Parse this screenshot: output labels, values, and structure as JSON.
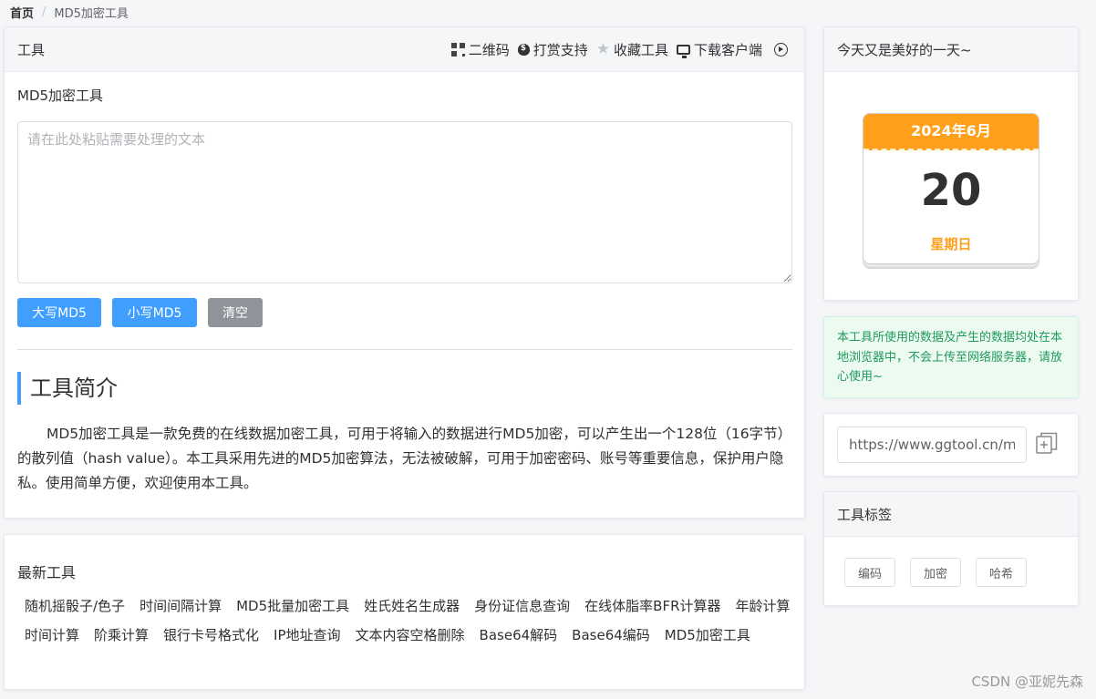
{
  "breadcrumb": {
    "home": "首页",
    "separator": "/",
    "current": "MD5加密工具"
  },
  "main": {
    "header_title": "工具",
    "actions": {
      "qr": "二维码",
      "donate": "打赏支持",
      "favorite": "收藏工具",
      "download": "下载客户端"
    },
    "tool_title": "MD5加密工具",
    "input_placeholder": "请在此处粘贴需要处理的文本",
    "buttons": {
      "upper": "大写MD5",
      "lower": "小写MD5",
      "clear": "清空"
    },
    "intro_title": "工具简介",
    "intro_text": "MD5加密工具是一款免费的在线数据加密工具，可用于将输入的数据进行MD5加密，可以产生出一个128位（16字节）的散列值（hash value）。本工具采用先进的MD5加密算法，无法被破解，可用于加密密码、账号等重要信息，保护用户隐私。使用简单方便，欢迎使用本工具。"
  },
  "latest": {
    "title": "最新工具",
    "items": [
      "随机摇骰子/色子",
      "时间间隔计算",
      "MD5批量加密工具",
      "姓氏姓名生成器",
      "身份证信息查询",
      "在线体脂率BFR计算器",
      "年龄计算",
      "时间计算",
      "阶乘计算",
      "银行卡号格式化",
      "IP地址查询",
      "文本内容空格删除",
      "Base64解码",
      "Base64编码",
      "MD5加密工具"
    ]
  },
  "calendar": {
    "header": "今天又是美好的一天~",
    "month": "2024年6月",
    "day": "20",
    "weekday": "星期日",
    "accent": "#ff9f1a"
  },
  "notice": {
    "text": "本工具所使用的数据及产生的数据均处在本地浏览器中，不会上传至网络服务器，请放心使用~"
  },
  "link": {
    "url": "https://www.ggtool.cn/md"
  },
  "tags": {
    "header": "工具标签",
    "items": [
      "编码",
      "加密",
      "哈希"
    ]
  },
  "watermark": "CSDN @亚妮先森",
  "colors": {
    "primary": "#409eff",
    "info": "#909399",
    "success_text": "#1f9a5a"
  }
}
